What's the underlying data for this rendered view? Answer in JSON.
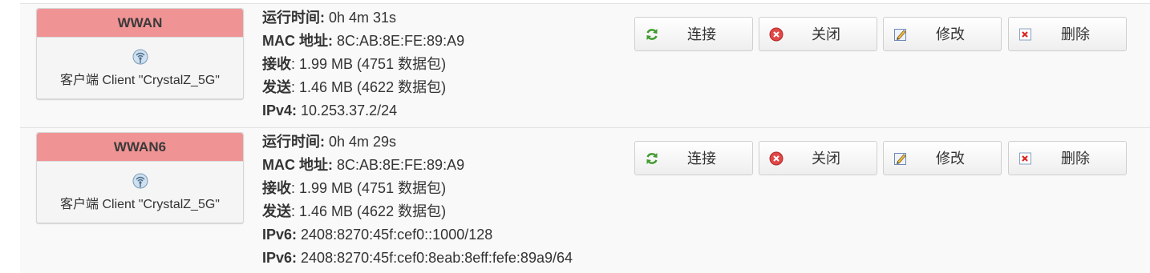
{
  "interfaces": [
    {
      "name": "WWAN",
      "client_desc": "客户端 Client \"CrystalZ_5G\"",
      "details": [
        {
          "key": "运行时间:",
          "value": " 0h 4m 31s"
        },
        {
          "key": "MAC 地址:",
          "value": " 8C:AB:8E:FE:89:A9"
        },
        {
          "key": "接收",
          "value": ": 1.99 MB (4751 数据包)"
        },
        {
          "key": "发送",
          "value": ": 1.46 MB (4622 数据包)"
        },
        {
          "key": "IPv4:",
          "value": " 10.253.37.2/24"
        }
      ]
    },
    {
      "name": "WWAN6",
      "client_desc": "客户端 Client \"CrystalZ_5G\"",
      "details": [
        {
          "key": "运行时间:",
          "value": " 0h 4m 29s"
        },
        {
          "key": "MAC 地址:",
          "value": " 8C:AB:8E:FE:89:A9"
        },
        {
          "key": "接收",
          "value": ": 1.99 MB (4751 数据包)"
        },
        {
          "key": "发送",
          "value": ": 1.46 MB (4622 数据包)"
        },
        {
          "key": "IPv6:",
          "value": " 2408:8270:45f:cef0::1000/128"
        },
        {
          "key": "IPv6:",
          "value": " 2408:8270:45f:cef0:8eab:8eff:fefe:89a9/64"
        }
      ]
    }
  ],
  "buttons": {
    "connect": "连接",
    "stop": "关闭",
    "edit": "修改",
    "delete": "删除"
  },
  "colors": {
    "header_bg": "#f09394",
    "row_bg": "#f9f9f9"
  }
}
